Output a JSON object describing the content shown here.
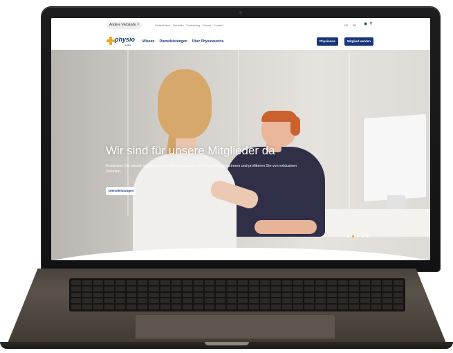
{
  "topbar": {
    "member_select": "Andere Verbände ˅",
    "links": "Stellenbörse · Aktuelles · Fortbildung · Presse · Kontakt",
    "lang_de": "DE",
    "lang_en": "EN",
    "account_icon": "user-icon",
    "search_icon": "search-icon"
  },
  "nav": {
    "logo_text": "physio",
    "logo_sub": "austria",
    "items": [
      "Wissen",
      "Dienstleistungen",
      "Über Physioaustria"
    ],
    "btn_physioone": "Physioone",
    "btn_member": "Mitglied werden"
  },
  "hero": {
    "title": "Wir sind für unsere Mitglieder da",
    "text": "Entdecken Sie unsere umfangreichen Dienstleistungen für Physiotherapeut:innen und profitieren Sie von exklusiven Vorteilen.",
    "button": "Dienstleistungen",
    "slides_total": 5,
    "slide_active": 2
  },
  "colors": {
    "brand_blue": "#16357a",
    "brand_orange": "#f5a623"
  }
}
